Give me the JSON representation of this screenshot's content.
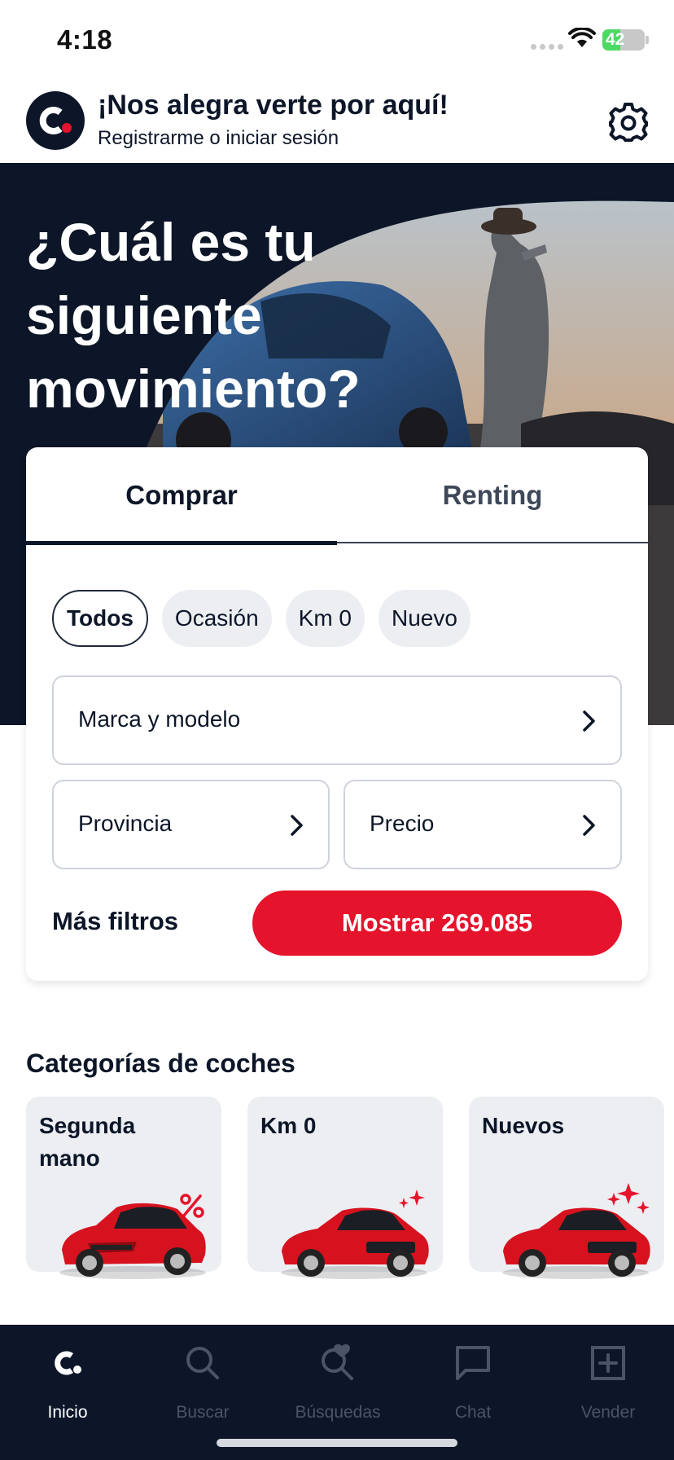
{
  "status_bar": {
    "time": "4:18",
    "battery_level": "42",
    "battery_fraction": 0.42,
    "icons": [
      "cellular-signal-icon",
      "wifi-icon",
      "battery-icon"
    ]
  },
  "header": {
    "greeting": "¡Nos alegra verte por aquí!",
    "login_link": "Registrarme o iniciar sesión",
    "logo_icon": "brand-logo-icon",
    "settings_icon": "gear-icon"
  },
  "hero": {
    "title": "¿Cuál es tu siguiente movimiento?"
  },
  "search": {
    "tabs": [
      {
        "label": "Comprar",
        "selected": true
      },
      {
        "label": "Renting",
        "selected": false
      }
    ],
    "chips": [
      {
        "label": "Todos",
        "selected": true
      },
      {
        "label": "Ocasión",
        "selected": false
      },
      {
        "label": "Km 0",
        "selected": false
      },
      {
        "label": "Nuevo",
        "selected": false
      }
    ],
    "fields": {
      "model": "Marca y modelo",
      "province": "Provincia",
      "price": "Precio"
    },
    "more_filters": "Más filtros",
    "show_button": "Mostrar 269.085"
  },
  "categories": {
    "title": "Categorías de coches",
    "items": [
      {
        "label": "Segunda mano",
        "decoration": "percent-icon"
      },
      {
        "label": "Km 0",
        "decoration": "sparkle-icon"
      },
      {
        "label": "Nuevos",
        "decoration": "sparkle-icon"
      }
    ]
  },
  "tab_bar": {
    "items": [
      {
        "label": "Inicio",
        "icon": "home-logo-icon",
        "active": true
      },
      {
        "label": "Buscar",
        "icon": "search-icon",
        "active": false
      },
      {
        "label": "Búsquedas",
        "icon": "saved-search-heart-icon",
        "active": false
      },
      {
        "label": "Chat",
        "icon": "chat-bubble-icon",
        "active": false
      },
      {
        "label": "Vender",
        "icon": "plus-square-icon",
        "active": false
      }
    ]
  },
  "colors": {
    "navy": "#0c1628",
    "brand_red": "#e5132c",
    "chip_bg": "#eceef2",
    "battery_green": "#4cd964"
  }
}
